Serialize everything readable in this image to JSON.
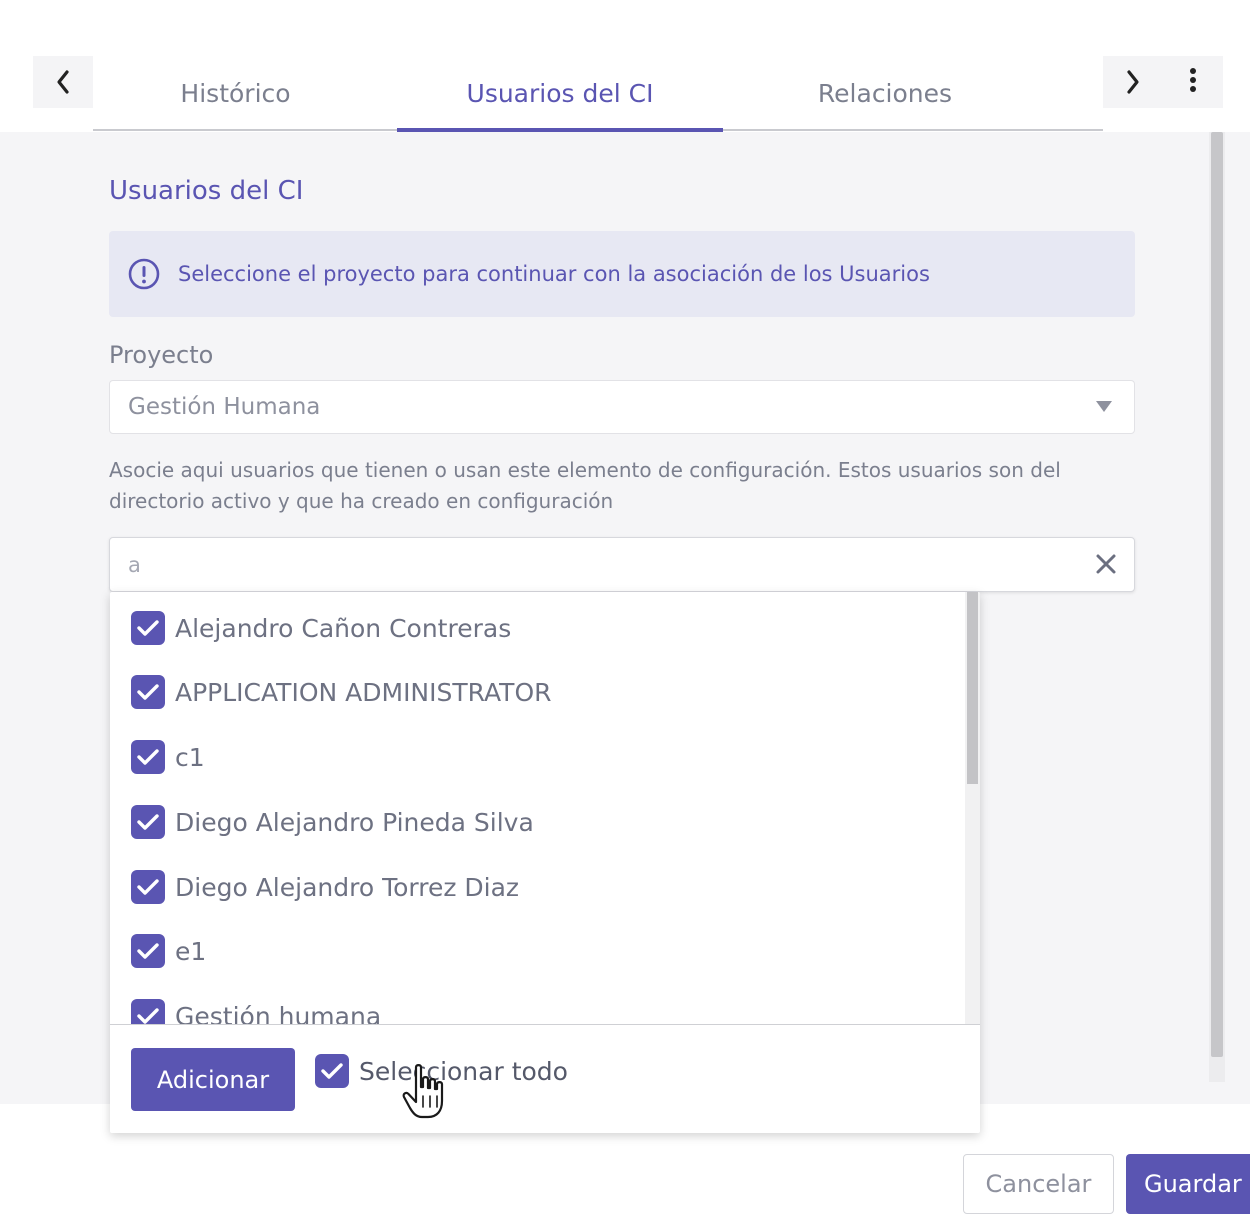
{
  "tabs": [
    {
      "label": "Histórico",
      "active": false
    },
    {
      "label": "Usuarios del CI",
      "active": true
    },
    {
      "label": "Relaciones",
      "active": false
    }
  ],
  "nav": {
    "prev_icon": "chevron-left-icon",
    "next_icon": "chevron-right-icon",
    "more_icon": "more-vertical-icon"
  },
  "section": {
    "title": "Usuarios del CI",
    "info_icon": "exclamation-circle-icon",
    "info_text": "Seleccione el proyecto para continuar con la asociación de los Usuarios"
  },
  "project": {
    "label": "Proyecto",
    "selected": "Gestión Humana",
    "arrow_icon": "caret-down-icon"
  },
  "help_text": "Asocie aqui usuarios que tienen o usan este elemento de configuración. Estos usuarios son del directorio activo y que ha creado en configuración",
  "search": {
    "value": "a",
    "clear_icon": "close-icon"
  },
  "users": [
    {
      "name": "Alejandro Cañon Contreras",
      "checked": true
    },
    {
      "name": "APPLICATION ADMINISTRATOR",
      "checked": true
    },
    {
      "name": "c1",
      "checked": true
    },
    {
      "name": "Diego Alejandro Pineda Silva",
      "checked": true
    },
    {
      "name": "Diego Alejandro Torrez Diaz",
      "checked": true
    },
    {
      "name": "e1",
      "checked": true
    },
    {
      "name": "Gestión humana",
      "checked": true
    }
  ],
  "dropdown_footer": {
    "add_label": "Adicionar",
    "select_all_label": "Seleccionar todo",
    "select_all_checked": true
  },
  "footer": {
    "cancel_label": "Cancelar",
    "save_label": "Guardar"
  },
  "colors": {
    "accent": "#5a55b2",
    "info_background": "#e7e8f3",
    "panel_background": "#f5f5f7"
  }
}
